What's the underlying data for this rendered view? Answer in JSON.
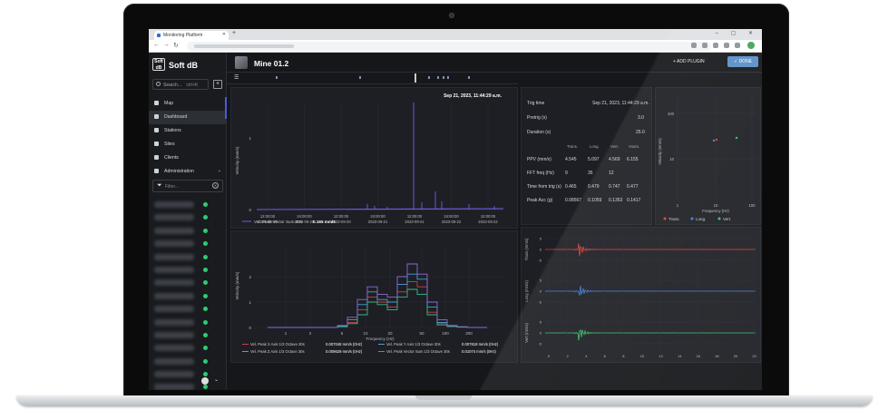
{
  "browser": {
    "tab_title": "Monitoring Platform",
    "new_tab": "+",
    "window_controls": "– ▢ ✕"
  },
  "sidebar": {
    "logo_text": "Soft dB",
    "brand": "Soft dB",
    "search_placeholder": "Search...",
    "search_suffix": "ctrl+K",
    "add_label": "+",
    "items": [
      {
        "label": "Map",
        "icon": "map-icon"
      },
      {
        "label": "Dashboard",
        "icon": "dashboard-icon",
        "active": true
      },
      {
        "label": "Stations",
        "icon": "station-icon"
      },
      {
        "label": "Sites",
        "icon": "location-icon"
      },
      {
        "label": "Clients",
        "icon": "clients-icon"
      },
      {
        "label": "Administration",
        "icon": "admin-icon"
      }
    ],
    "filter_placeholder": "Filter...",
    "station_count": 16
  },
  "header": {
    "title": "Mine 01.2",
    "add_plugin": "+ ADD PLUGIN",
    "done": "✓ DONE"
  },
  "timeseries": {
    "timestamp": "Sep 21, 2023, 11:44:29 a.m.",
    "ylabel": "Velocity (mm/s)",
    "y_ticks": [
      "0",
      "1"
    ],
    "x_ticks": [
      [
        "12:00:00",
        "2023-09-19"
      ],
      [
        "24:00:00",
        "2023-09-20"
      ],
      [
        "12:00:00",
        "2023-09-20"
      ],
      [
        "24:00:00",
        "2023-09-21"
      ],
      [
        "12:00:00",
        "2023-09-21"
      ],
      [
        "24:00:00",
        "2023-09-22"
      ],
      [
        "12:00:00",
        "2023-09-22"
      ]
    ],
    "legend": "Vel. Peak Vector Sum 30s",
    "legend_value": "0.165 mm/s"
  },
  "trig_info": {
    "trig_time_label": "Trig time",
    "trig_time": "Sep 21, 2023, 11:44:29 a.m.",
    "pretrig_label": "Pretrig (s)",
    "pretrig": "3.0",
    "duration_label": "Duration (s)",
    "duration": "25.0",
    "columns": [
      "Trans.",
      "Long.",
      "Vert.",
      "Vsum."
    ],
    "rows": [
      {
        "label": "PPV (mm/s)",
        "values": [
          "4.545",
          "5.097",
          "4.569",
          "6.155"
        ]
      },
      {
        "label": "FFT freq (Hz)",
        "values": [
          "9",
          "35",
          "12",
          ""
        ]
      },
      {
        "label": "Time from trig (s)",
        "values": [
          "0.465",
          "0.479",
          "0.747",
          "0.477"
        ]
      },
      {
        "label": "Peak Acc (g)",
        "values": [
          "0.08567",
          "0.1059",
          "0.1353",
          "0.1417"
        ]
      }
    ]
  },
  "freq_scatter": {
    "y_label": "Velocity (mm/s)",
    "x_label": "Frequency (Hz)",
    "y_ticks": [
      "100",
      "10"
    ],
    "x_ticks": [
      "1",
      "10",
      "100"
    ],
    "legend": [
      {
        "label": "Trans.",
        "color": "#e03b3b",
        "marker": "dot"
      },
      {
        "label": "Long.",
        "color": "#3f7fe0",
        "marker": "dot"
      },
      {
        "label": "Vert.",
        "color": "#33c36b",
        "marker": "star"
      }
    ]
  },
  "octave": {
    "ylabel": "Velocity (mm/s)",
    "xlabel": "Frequency (Hz)",
    "y_ticks": [
      "0",
      "1",
      "2"
    ],
    "x_ticks": [
      "1",
      "2",
      "5",
      "10",
      "20",
      "50",
      "100",
      "200"
    ],
    "legend": [
      {
        "label": "Vel. Peak X Axis 1/3 Octave 30s",
        "value": "0.007048 mm/s (0Hz)",
        "color": "#d04040"
      },
      {
        "label": "Vel. Peak Y Axis 1/3 Octave 30s",
        "value": "0.007618 mm/s (0Hz)",
        "color": "#4aa0d8"
      },
      {
        "label": "Vel. Peak Z Axis 1/3 Octave 30s",
        "value": "0.009629 mm/s (0Hz)",
        "color": "#38b88a"
      },
      {
        "label": "Vel. Peak Vector Sum 1/3 Octave 30s",
        "value": "0.01074 mm/s (0Hz)",
        "color": "#8f6ad8"
      }
    ]
  },
  "waveform": {
    "channels": [
      {
        "label": "Trans (mm/s)",
        "color": "#e03b3b"
      },
      {
        "label": "Long (mm/s)",
        "color": "#3f7fe0"
      },
      {
        "label": "Vert (mm/s)",
        "color": "#33c36b"
      }
    ],
    "y_ticks": [
      "5",
      "0",
      "-5"
    ],
    "x_ticks": [
      "0",
      "2",
      "4",
      "6",
      "8",
      "10",
      "12",
      "14",
      "16",
      "18",
      "20",
      "22"
    ]
  }
}
